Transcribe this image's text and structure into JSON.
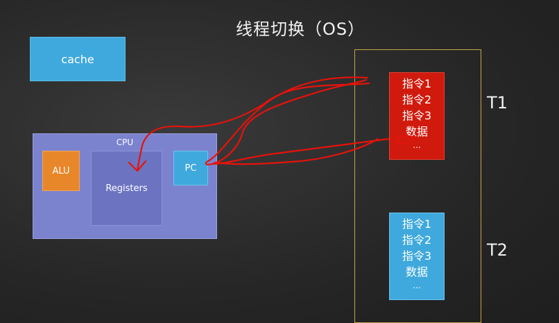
{
  "title": "线程切换（OS）",
  "cache_label": "cache",
  "cpu": {
    "label": "CPU",
    "alu": "ALU",
    "registers": "Registers",
    "pc": "PC"
  },
  "threads": [
    {
      "name": "T1",
      "color": "#d01a0d",
      "lines": [
        "指令1",
        "指令2",
        "指令3",
        "数据"
      ],
      "ellipsis": "..."
    },
    {
      "name": "T2",
      "color": "#3fa9dd",
      "lines": [
        "指令1",
        "指令2",
        "指令3",
        "数据"
      ],
      "ellipsis": "..."
    }
  ],
  "annotation_color": "#e8120a"
}
